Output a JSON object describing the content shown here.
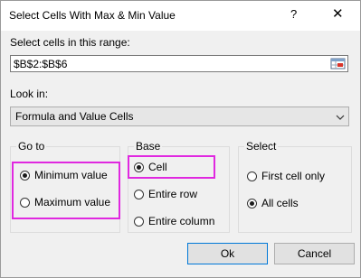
{
  "window": {
    "title": "Select Cells With Max & Min Value",
    "help_label": "?",
    "close_label": "✕"
  },
  "range": {
    "label": "Select cells in this range:",
    "value": "$B$2:$B$6",
    "picker_icon": "range-picker-icon"
  },
  "look_in": {
    "label": "Look in:",
    "selected": "Formula and Value Cells",
    "arrow_icon": "chevron-down-icon"
  },
  "go_to": {
    "title": "Go to",
    "options": [
      {
        "label": "Minimum value",
        "checked": true
      },
      {
        "label": "Maximum value",
        "checked": false
      }
    ]
  },
  "base": {
    "title": "Base",
    "options": [
      {
        "label": "Cell",
        "checked": true
      },
      {
        "label": "Entire row",
        "checked": false
      },
      {
        "label": "Entire column",
        "checked": false
      }
    ]
  },
  "select": {
    "title": "Select",
    "options": [
      {
        "label": "First cell only",
        "checked": false
      },
      {
        "label": "All cells",
        "checked": true
      }
    ]
  },
  "buttons": {
    "ok": "Ok",
    "cancel": "Cancel"
  },
  "highlight_color": "#e028e0"
}
